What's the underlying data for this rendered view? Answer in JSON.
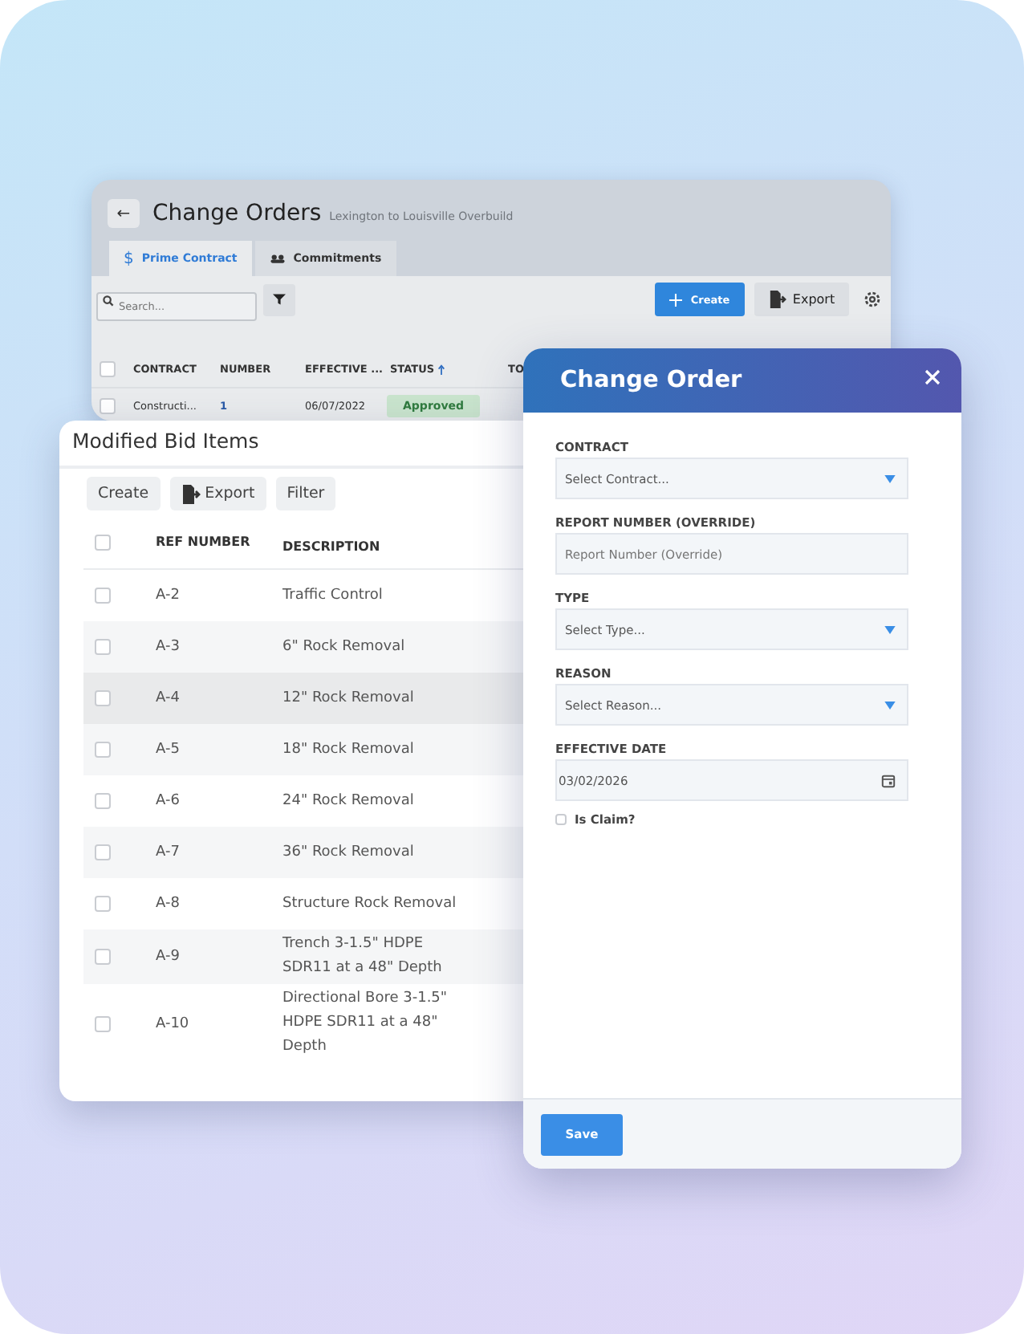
{
  "change_orders_window": {
    "back_label": "←",
    "title": "Change Orders",
    "subtitle": "Lexington to Louisville Overbuild",
    "tabs": [
      {
        "icon": "$",
        "label": "Prime Contract",
        "selected": true
      },
      {
        "label": "Commitments",
        "selected": false
      }
    ],
    "search": {
      "placeholder": "Search..."
    },
    "create_button": "Create",
    "export_button": "Export",
    "table": {
      "select_all_checked": false,
      "columns": [
        "CONTRACT",
        "NUMBER",
        "EFFECTIVE ...",
        "STATUS",
        "TO"
      ],
      "rows": [
        {
          "checked": false,
          "contract": "Constructi...",
          "number": "1",
          "effective": "06/07/2022",
          "status": "Approved"
        }
      ]
    }
  },
  "bid_items_window": {
    "title": "Modified Bid Items",
    "toolbar": [
      {
        "label": "Create",
        "kind": "plain"
      },
      {
        "label": "Export",
        "kind": "export"
      },
      {
        "label": "Filter",
        "kind": "plain"
      }
    ],
    "table": {
      "select_all_checked": false,
      "columns": [
        "REF NUMBER",
        "DESCRIPTION"
      ],
      "rows": [
        {
          "checked": false,
          "selected": false,
          "ref": "A-2",
          "description": "Traffic Control"
        },
        {
          "checked": false,
          "selected": false,
          "ref": "A-3",
          "description": "6\" Rock Removal"
        },
        {
          "checked": false,
          "selected": true,
          "ref": "A-4",
          "description": "12\" Rock Removal"
        },
        {
          "checked": false,
          "selected": false,
          "ref": "A-5",
          "description": "18\" Rock Removal"
        },
        {
          "checked": false,
          "selected": false,
          "ref": "A-6",
          "description": "24\" Rock Removal"
        },
        {
          "checked": false,
          "selected": false,
          "ref": "A-7",
          "description": "36\" Rock Removal"
        },
        {
          "checked": false,
          "selected": false,
          "ref": "A-8",
          "description": "Structure Rock Removal"
        },
        {
          "checked": false,
          "selected": false,
          "ref": "A-9",
          "description": "Trench 3-1.5\" HDPE SDR11 at a 48\" Depth"
        },
        {
          "checked": false,
          "selected": false,
          "ref": "A-10",
          "description": "Directional Bore 3-1.5\" HDPE SDR11 at a 48\" Depth"
        }
      ]
    }
  },
  "change_order_dialog": {
    "title": "Change Order",
    "fields": [
      {
        "label": "CONTRACT",
        "kind": "select",
        "placeholder": "Select Contract..."
      },
      {
        "label": "REPORT NUMBER (OVERRIDE)",
        "kind": "text",
        "placeholder": "Report Number (Override)"
      },
      {
        "label": "TYPE",
        "kind": "select",
        "placeholder": "Select Type..."
      },
      {
        "label": "REASON",
        "kind": "select",
        "placeholder": "Select Reason..."
      },
      {
        "label": "EFFECTIVE DATE",
        "kind": "date",
        "value": "03/02/2026"
      }
    ],
    "claim": {
      "label": "Is Claim?",
      "checked": false
    },
    "save_button": "Save"
  }
}
